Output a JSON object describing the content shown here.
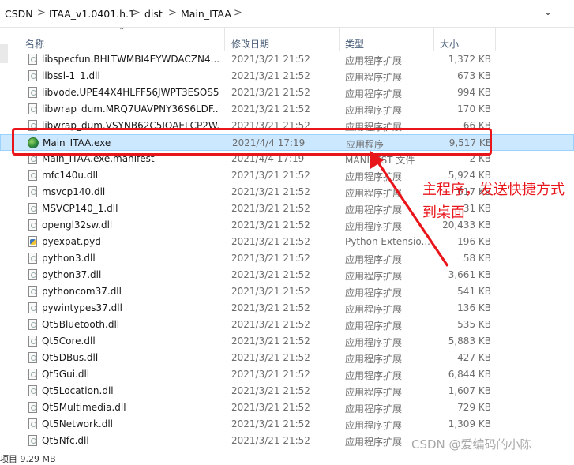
{
  "address_bar": {
    "segments": [
      "CSDN",
      "ITAA_v1.0401.h.1",
      "dist",
      "Main_ITAA"
    ],
    "separator": ">",
    "dropdown_glyph": "⌄"
  },
  "columns": {
    "name": "名称",
    "date": "修改日期",
    "type": "类型",
    "size": "大小"
  },
  "files": [
    {
      "name": "libspecfun.BHLTWMBI4EYWDACZN4...",
      "date": "2021/3/21 21:52",
      "type": "应用程序扩展",
      "size": "1,372 KB",
      "icon": "dll-icon"
    },
    {
      "name": "libssl-1_1.dll",
      "date": "2021/3/21 21:52",
      "type": "应用程序扩展",
      "size": "673 KB",
      "icon": "dll-icon"
    },
    {
      "name": "libvode.UPE44X4HLFF56JWPT3ESOS5...",
      "date": "2021/3/21 21:52",
      "type": "应用程序扩展",
      "size": "994 KB",
      "icon": "dll-icon"
    },
    {
      "name": "libwrap_dum.MRQ7UAVPNY36S6LDF...",
      "date": "2021/3/21 21:52",
      "type": "应用程序扩展",
      "size": "170 KB",
      "icon": "dll-icon"
    },
    {
      "name": "libwrap_dum.VSYNB62C5IOAELCP2W...",
      "date": "2021/3/21 21:52",
      "type": "应用程序扩展",
      "size": "66 KB",
      "icon": "dll-icon"
    },
    {
      "name": "Main_ITAA.exe",
      "date": "2021/4/4 17:19",
      "type": "应用程序",
      "size": "9,517 KB",
      "icon": "exe-icon",
      "selected": true
    },
    {
      "name": "Main_ITAA.exe.manifest",
      "date": "2021/4/4 17:19",
      "type": "MANIFEST 文件",
      "size": "2 KB",
      "icon": "manifest-icon"
    },
    {
      "name": "mfc140u.dll",
      "date": "2021/3/21 21:52",
      "type": "应用程序扩展",
      "size": "5,924 KB",
      "icon": "dll-icon"
    },
    {
      "name": "msvcp140.dll",
      "date": "2021/3/21 21:52",
      "type": "应用程序扩展",
      "size": "617 KB",
      "icon": "dll-icon"
    },
    {
      "name": "MSVCP140_1.dll",
      "date": "2021/3/21 21:52",
      "type": "应用程序扩展",
      "size": "31 KB",
      "icon": "dll-icon"
    },
    {
      "name": "opengl32sw.dll",
      "date": "2021/3/21 21:52",
      "type": "应用程序扩展",
      "size": "20,433 KB",
      "icon": "dll-icon"
    },
    {
      "name": "pyexpat.pyd",
      "date": "2021/3/21 21:52",
      "type": "Python Extensio...",
      "size": "196 KB",
      "icon": "pyd-icon"
    },
    {
      "name": "python3.dll",
      "date": "2021/3/21 21:52",
      "type": "应用程序扩展",
      "size": "58 KB",
      "icon": "dll-icon"
    },
    {
      "name": "python37.dll",
      "date": "2021/3/21 21:52",
      "type": "应用程序扩展",
      "size": "3,661 KB",
      "icon": "dll-icon"
    },
    {
      "name": "pythoncom37.dll",
      "date": "2021/3/21 21:52",
      "type": "应用程序扩展",
      "size": "541 KB",
      "icon": "dll-icon"
    },
    {
      "name": "pywintypes37.dll",
      "date": "2021/3/21 21:52",
      "type": "应用程序扩展",
      "size": "136 KB",
      "icon": "dll-icon"
    },
    {
      "name": "Qt5Bluetooth.dll",
      "date": "2021/3/21 21:52",
      "type": "应用程序扩展",
      "size": "535 KB",
      "icon": "dll-icon"
    },
    {
      "name": "Qt5Core.dll",
      "date": "2021/3/21 21:52",
      "type": "应用程序扩展",
      "size": "5,883 KB",
      "icon": "dll-icon"
    },
    {
      "name": "Qt5DBus.dll",
      "date": "2021/3/21 21:52",
      "type": "应用程序扩展",
      "size": "427 KB",
      "icon": "dll-icon"
    },
    {
      "name": "Qt5Gui.dll",
      "date": "2021/3/21 21:52",
      "type": "应用程序扩展",
      "size": "6,844 KB",
      "icon": "dll-icon"
    },
    {
      "name": "Qt5Location.dll",
      "date": "2021/3/21 21:52",
      "type": "应用程序扩展",
      "size": "1,607 KB",
      "icon": "dll-icon"
    },
    {
      "name": "Qt5Multimedia.dll",
      "date": "2021/3/21 21:52",
      "type": "应用程序扩展",
      "size": "729 KB",
      "icon": "dll-icon"
    },
    {
      "name": "Qt5Network.dll",
      "date": "2021/3/21 21:52",
      "type": "应用程序扩展",
      "size": "1,309 KB",
      "icon": "dll-icon"
    },
    {
      "name": "Qt5Nfc.dll",
      "date": "2021/3/21 21:52",
      "type": "应用程序扩展",
      "size": "",
      "icon": "dll-icon"
    }
  ],
  "status_bar": {
    "text": "项目  9.29 MB"
  },
  "annotation": {
    "text": "主程序，发送快捷方式到桌面",
    "color": "#e8161b"
  },
  "watermark": {
    "text": "CSDN @爱编码的小陈"
  },
  "colors": {
    "selection_bg": "#cce8ff",
    "selection_border": "#99d1ff",
    "header_text": "#4c607a",
    "annotation_red": "#e8161b"
  }
}
